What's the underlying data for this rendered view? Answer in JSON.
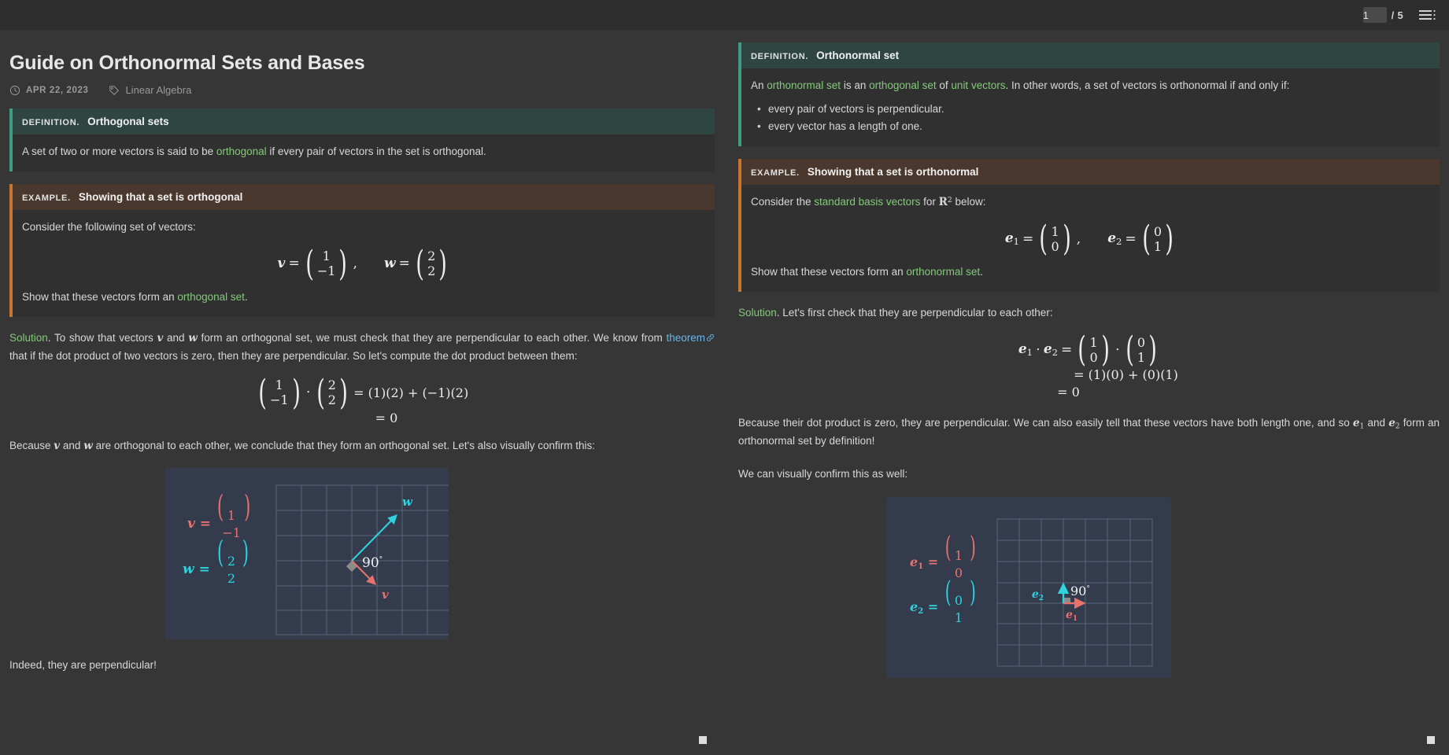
{
  "topbar": {
    "current_page": "1",
    "page_total": "/ 5",
    "menu_icon": "hamburger-menu-icon"
  },
  "article": {
    "title": "Guide on Orthonormal Sets and Bases",
    "date": "APR 22, 2023",
    "date_icon": "clock-icon",
    "tag": "Linear Algebra",
    "tag_icon": "tag-icon"
  },
  "left": {
    "definition": {
      "kind": "DEFINITION.",
      "name": "Orthogonal sets",
      "body_pre": "A set of two or more vectors is said to be ",
      "body_link": "orthogonal",
      "body_post": " if every pair of vectors in the set is orthogonal."
    },
    "example": {
      "kind": "EXAMPLE.",
      "name": "Showing that a set is orthogonal",
      "intro": "Consider the following set of vectors:",
      "math": {
        "v_label": "v",
        "v_top": "1",
        "v_bottom": "−1",
        "comma": ",",
        "w_label": "w",
        "w_top": "2",
        "w_bottom": "2"
      },
      "closing_pre": "Show that these vectors form an ",
      "closing_link": "orthogonal set",
      "closing_post": "."
    },
    "solution": {
      "label": "Solution",
      "text_1": ". To show that vectors ",
      "v": "v",
      "text_2": " and ",
      "w": "w",
      "text_3": " form an orthogonal set, we must check that they are perpendicular to each other. We know from ",
      "link": "theorem",
      "text_4": " that if the dot product of two vectors is zero, then they are perpendicular. So let's compute the dot product between them:"
    },
    "dot_math": {
      "a_top": "1",
      "a_bottom": "−1",
      "dot": "⋅",
      "b_top": "2",
      "b_bottom": "2",
      "eq_1": "= (1)(2) + (−1)(2)",
      "eq_2": "= 0"
    },
    "conclusion": {
      "pre": "Because ",
      "v": "v",
      "mid": " and ",
      "w": "w",
      "post": " are orthogonal to each other, we conclude that they form an orthogonal set. Let's also visually confirm this:"
    },
    "figure": {
      "v_label": "v",
      "v_top": "1",
      "v_bottom": "−1",
      "w_label": "w",
      "w_top": "2",
      "w_bottom": "2",
      "angle_label": "90",
      "angle_degree": "°",
      "vector_v_color": "#e8736e",
      "vector_w_color": "#2ed3e0",
      "grid_color": "#5b6479",
      "panel_color": "#333b4c"
    },
    "final_note": "Indeed, they are perpendicular!"
  },
  "right": {
    "definition": {
      "kind": "DEFINITION.",
      "name": "Orthonormal set",
      "body_pre": "An ",
      "link_1": "orthonormal set",
      "body_mid_1": " is an ",
      "link_2": "orthogonal set",
      "body_mid_2": " of ",
      "link_3": "unit vectors",
      "body_post": ". In other words, a set of vectors is orthonormal if and only if:",
      "bullets": [
        "every pair of vectors is perpendicular.",
        "every vector has a length of one."
      ]
    },
    "example": {
      "kind": "EXAMPLE.",
      "name": "Showing that a set is orthonormal",
      "intro_pre": "Consider the ",
      "intro_link": "standard basis vectors",
      "intro_mid": " for ",
      "intro_field": "R",
      "intro_exp": "2",
      "intro_post": " below:",
      "math": {
        "e1_label": "e",
        "e1_sub": "1",
        "e1_top": "1",
        "e1_bottom": "0",
        "comma": ",",
        "e2_label": "e",
        "e2_sub": "2",
        "e2_top": "0",
        "e2_bottom": "1"
      },
      "closing_pre": "Show that these vectors form an ",
      "closing_link": "orthonormal set",
      "closing_post": "."
    },
    "solution": {
      "label": "Solution",
      "text": ". Let's first check that they are perpendicular to each other:"
    },
    "dot_math": {
      "e1": "e",
      "e1_sub": "1",
      "dot_op": "⋅",
      "e2": "e",
      "e2_sub": "2",
      "equals": "=",
      "a_top": "1",
      "a_bottom": "0",
      "dot": "⋅",
      "b_top": "0",
      "b_bottom": "1",
      "eq_1": "= (1)(0) + (0)(1)",
      "eq_2": "= 0"
    },
    "conclusion": {
      "pre": "Because their dot product is zero, they are perpendicular. We can also easily tell that these vectors have both length one, and so ",
      "e1": "e",
      "e1_sub": "1",
      "mid": " and ",
      "e2": "e",
      "e2_sub": "2",
      "post": " form an orthonormal set by definition!"
    },
    "visual_intro": "We can visually confirm this as well:",
    "figure": {
      "e1_label": "e",
      "e1_sub": "1",
      "e1_top": "1",
      "e1_bottom": "0",
      "e2_label": "e",
      "e2_sub": "2",
      "e2_top": "0",
      "e2_bottom": "1",
      "angle_label": "90",
      "angle_degree": "°",
      "vector_e1_color": "#e8736e",
      "vector_e2_color": "#2ed3e0",
      "grid_color": "#5b6479",
      "panel_color": "#333b4c"
    }
  },
  "theme": {
    "background": "#363636",
    "definition_accent": "#3f9d84",
    "definition_header": "#2e4541",
    "example_accent": "#c8762f",
    "example_header": "#4a382e",
    "link_green": "#84c97b",
    "link_blue": "#6bb6e8"
  }
}
